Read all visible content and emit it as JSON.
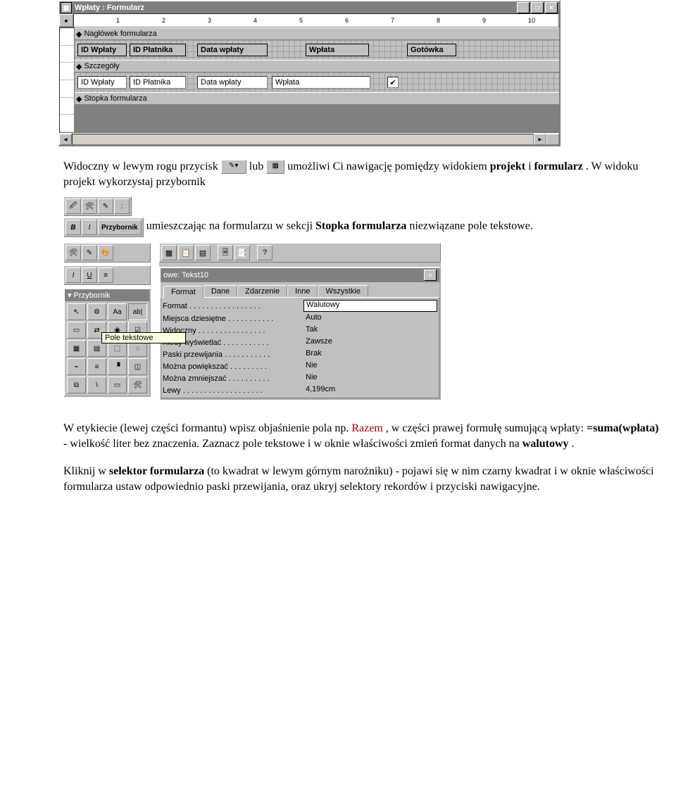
{
  "figure1": {
    "title": "Wpłaty : Formularz",
    "ruler_numbers": [
      1,
      2,
      3,
      4,
      5,
      6,
      7,
      8,
      9,
      10
    ],
    "sections": {
      "header_bar": "Nagłówek formularza",
      "detail_bar": "Szczegóły",
      "footer_bar": "Stopka formularza"
    },
    "header_labels": [
      "ID Wpłaty",
      "ID Płatnika",
      "Data wpłaty",
      "Wpłata",
      "Gotówka"
    ],
    "detail_fields": [
      "ID Wpłaty",
      "ID Płatnika",
      "Data wpłaty",
      "Wpłata"
    ],
    "detail_checkbox_checked": "✔"
  },
  "para1_a": "Widoczny w lewym rogu przycisk ",
  "para1_b": " lub ",
  "para1_c": " umożliwi Ci nawigację pomiędzy widokiem ",
  "para1_bold1": "projekt",
  "para1_d": " i ",
  "para1_bold2": "formularz",
  "para1_e": ". W widoku projekt wykorzystaj przybornik",
  "para2_a": "umieszczając na formularzu w sekcji ",
  "para2_bold": "Stopka formularza",
  "para2_b": " niezwiązane pole tekstowe.",
  "toolbox_label": "Przybornik",
  "palette_title": "Przybornik",
  "tooltip_text": "Pole tekstowe",
  "palette_cells": [
    "↖",
    "⚙",
    "Aa",
    "ab|",
    "▭",
    "⇄",
    "◉",
    "☑",
    "▦",
    "▤",
    "⬚",
    "◌",
    "⌁",
    "≡",
    "▝",
    "◫",
    "⧉",
    "\\",
    "▭",
    "🛠"
  ],
  "props": {
    "title": "owe: Tekst10",
    "tabs": [
      "Format",
      "Dane",
      "Zdarzenie",
      "Inne",
      "Wszystkie"
    ],
    "rows": [
      {
        "label": "Format . . . . . . . . . . . . . . . . .",
        "value": "Walutowy"
      },
      {
        "label": "Miejsca dziesiętne . . . . . . . . . . .",
        "value": "Auto"
      },
      {
        "label": "Widoczny . . . . . . . . . . . . . . . .",
        "value": "Tak"
      },
      {
        "label": "Kiedy wyświetlać . . . . . . . . . . .",
        "value": "Zawsze"
      },
      {
        "label": "Paski przewijania . . . . . . . . . . .",
        "value": "Brak"
      },
      {
        "label": "Można powiększać . . . . . . . . .",
        "value": "Nie"
      },
      {
        "label": "Można zmniejszać . . . . . . . . . .",
        "value": "Nie"
      },
      {
        "label": "Lewy . . . . . . . . . . . . . . . . . . .",
        "value": "4,199cm"
      }
    ]
  },
  "para3_a": "W etykiecie (lewej części formantu) wpisz objaśnienie pola np. ",
  "para3_red": "Razem",
  "para3_b": ", w części prawej formułę sumującą wpłaty: ",
  "para3_bold1": "=suma(wpłata)",
  "para3_c": " - wielkość liter bez znaczenia. Zaznacz pole tekstowe i w oknie właściwości zmień format danych na ",
  "para3_bold2": "walutowy",
  "para3_d": ".",
  "para4_a": "Kliknij w ",
  "para4_bold1": "selektor formularza",
  "para4_b": " (to kwadrat w lewym górnym narożniku) - pojawi się w nim czarny kwadrat i w oknie właściwości formularza ustaw odpowiednio paski przewijania, oraz ukryj selektory rekordów i przyciski nawigacyjne."
}
